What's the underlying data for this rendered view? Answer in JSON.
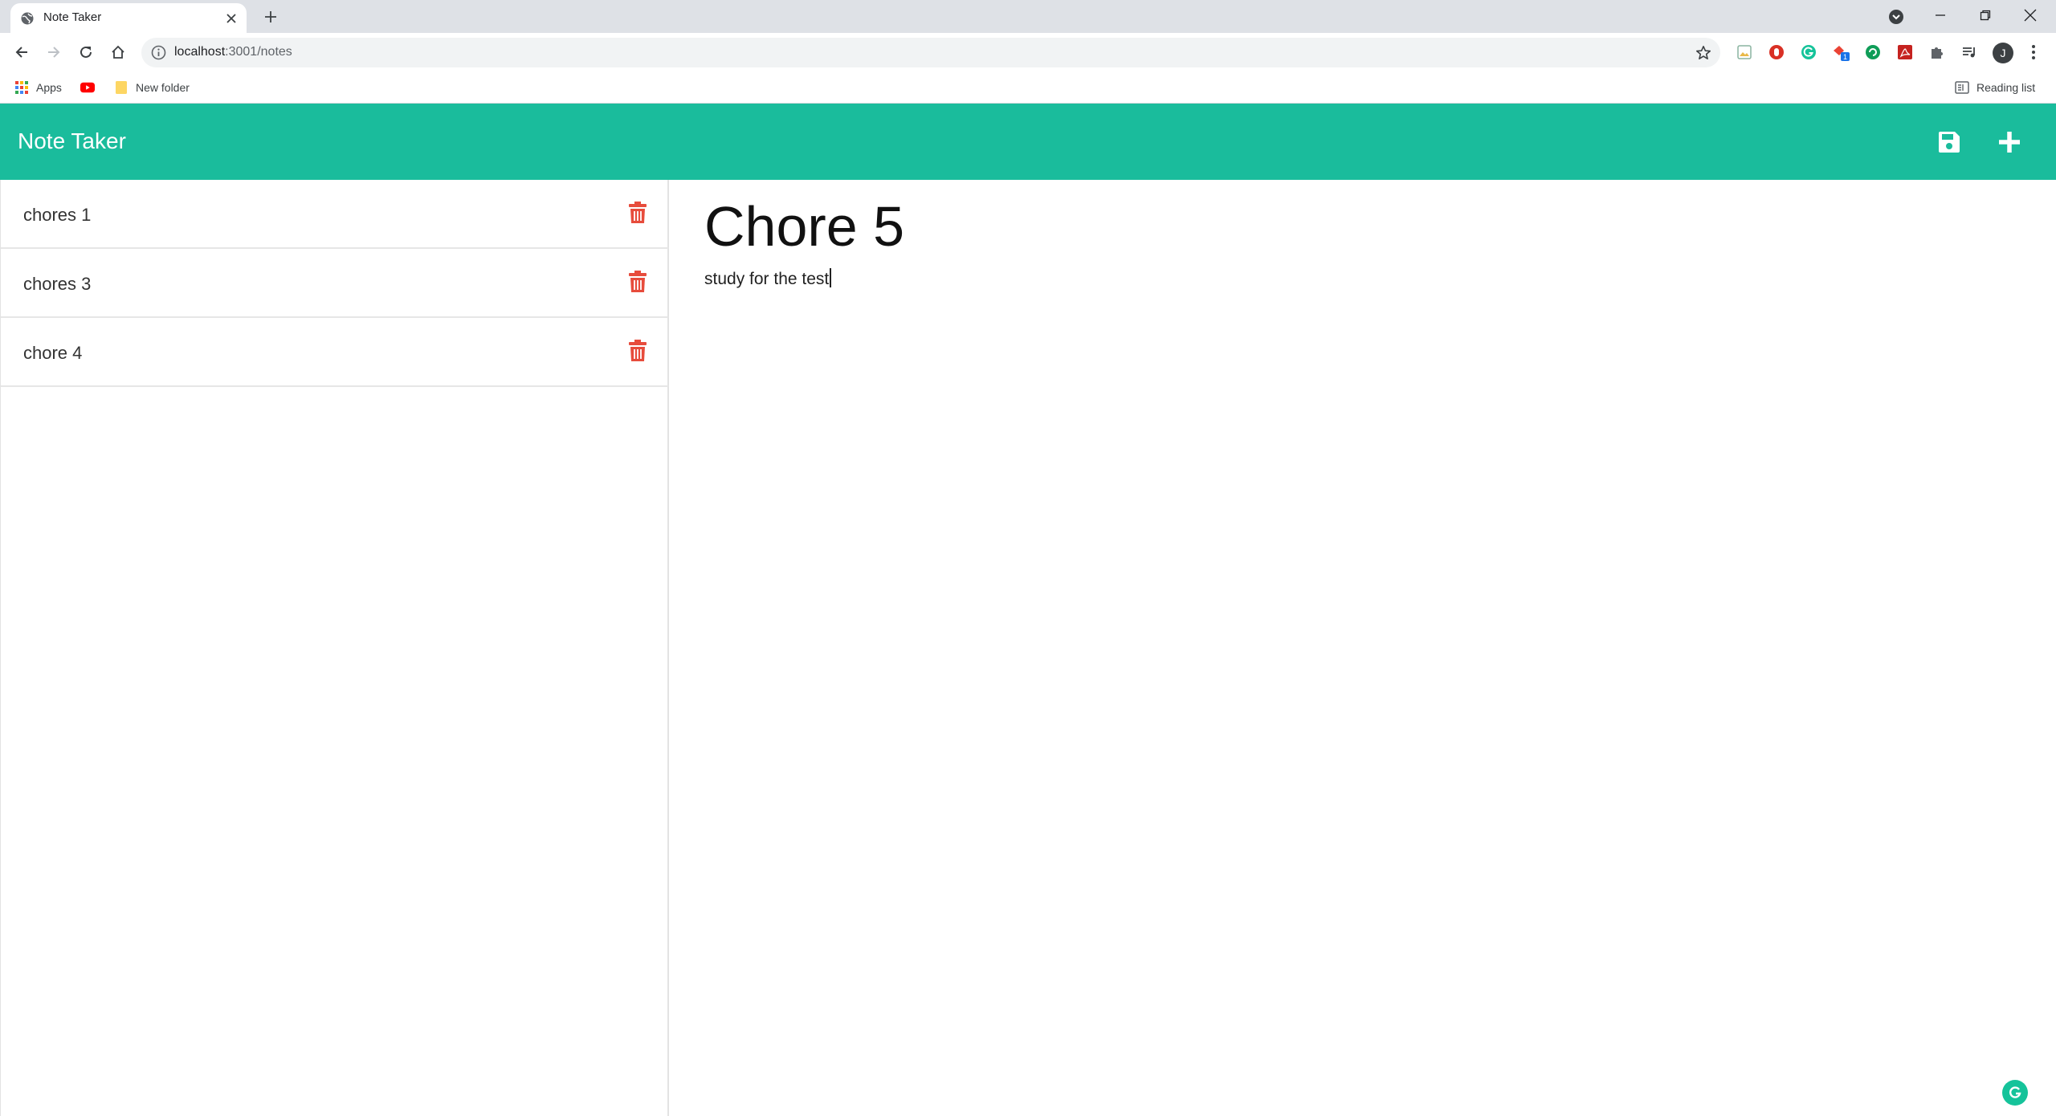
{
  "browser": {
    "tab": {
      "title": "Note Taker",
      "favicon": "globe-icon"
    },
    "url": {
      "host": "localhost",
      "rest": ":3001/notes"
    },
    "bookmarks": [
      {
        "label": "Apps",
        "icon": "apps-grid-icon"
      },
      {
        "label": "",
        "icon": "youtube-icon"
      },
      {
        "label": "New folder",
        "icon": "folder-icon"
      }
    ],
    "reading_list": "Reading list",
    "profile_initial": "J",
    "extensions": [
      "extension-image-icon",
      "extension-red-icon",
      "grammarly-icon",
      "extension-badge-icon",
      "extension-green-icon",
      "pdf-icon",
      "puzzle-icon",
      "media-icon"
    ],
    "extension_badge": "1"
  },
  "app": {
    "title": "Note Taker",
    "accent": "#1abc9c",
    "delete_color": "#e74c3c"
  },
  "notes": [
    {
      "title": "chores 1"
    },
    {
      "title": "chores 3"
    },
    {
      "title": "chore 4"
    }
  ],
  "active_note": {
    "title": "Chore 5",
    "text": "study for the test"
  }
}
